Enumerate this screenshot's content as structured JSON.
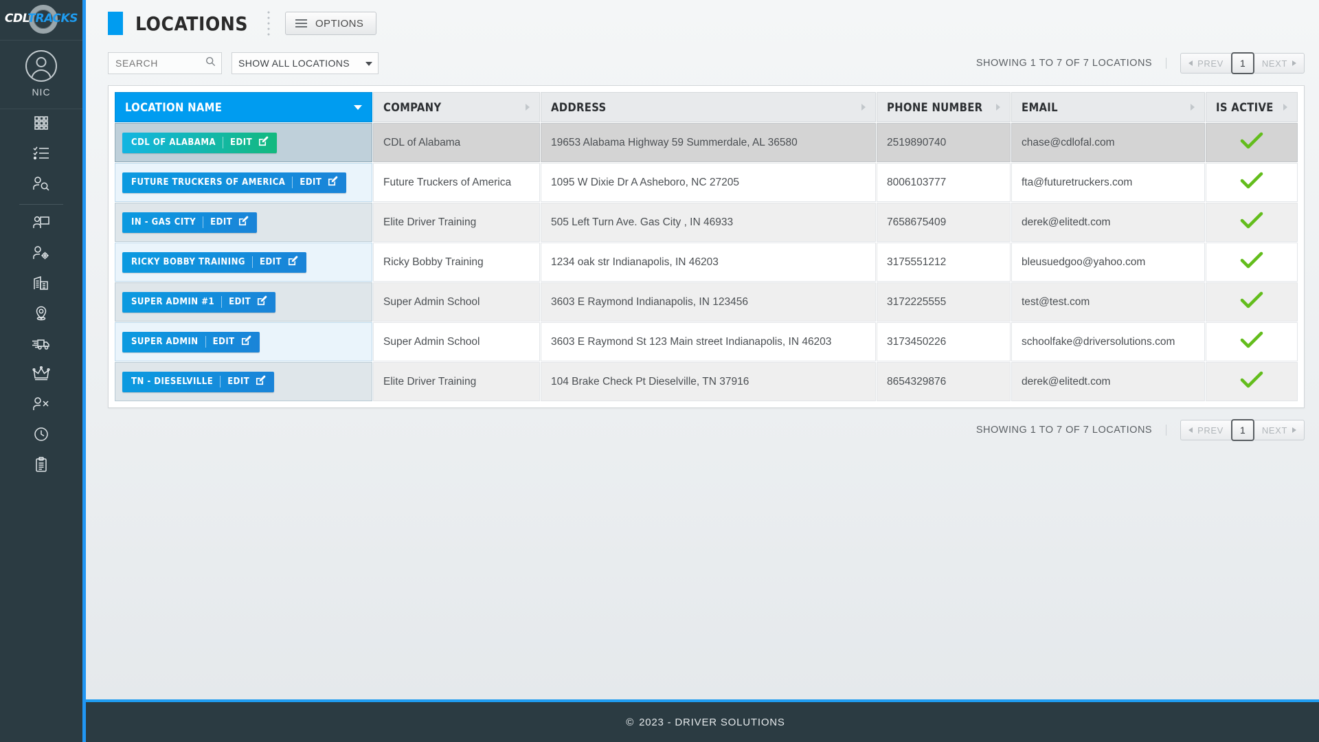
{
  "brand": {
    "name_part1": "CDL",
    "name_part2": "TRACKS"
  },
  "sidebar": {
    "user": {
      "name": "NIC",
      "avatar_icon": "user-avatar-icon"
    },
    "items": [
      {
        "icon": "grid-dashboard-icon",
        "name": "dashboard"
      },
      {
        "icon": "checklist-icon",
        "name": "tasks"
      },
      {
        "icon": "user-search-icon",
        "name": "student-search"
      },
      {
        "icon": "presentation-user-icon",
        "name": "training"
      },
      {
        "icon": "user-settings-icon",
        "name": "user-settings"
      },
      {
        "icon": "building-icon",
        "name": "companies"
      },
      {
        "icon": "location-pin-icon",
        "name": "locations"
      },
      {
        "icon": "truck-icon",
        "name": "vehicles"
      },
      {
        "icon": "crown-icon",
        "name": "admin"
      },
      {
        "icon": "user-remove-icon",
        "name": "remove-user"
      },
      {
        "icon": "clock-icon",
        "name": "hours"
      },
      {
        "icon": "clipboard-icon",
        "name": "reports"
      }
    ]
  },
  "header": {
    "title": "LOCATIONS",
    "options_label": "OPTIONS",
    "accent_color": "#009cf0"
  },
  "toolbar": {
    "search_placeholder": "SEARCH",
    "search_value": "",
    "filter_selected": "SHOW ALL LOCATIONS",
    "filter_options": [
      "SHOW ALL LOCATIONS"
    ],
    "showing_text": "SHOWING 1 TO 7 OF 7 LOCATIONS",
    "pagination": {
      "prev_label": "PREV",
      "page_label": "1",
      "next_label": "NEXT"
    }
  },
  "table": {
    "columns": [
      {
        "label": "LOCATION NAME",
        "sorted": true,
        "sort_dir": "desc"
      },
      {
        "label": "COMPANY",
        "sorted": false
      },
      {
        "label": "ADDRESS",
        "sorted": false
      },
      {
        "label": "PHONE NUMBER",
        "sorted": false
      },
      {
        "label": "EMAIL",
        "sorted": false
      },
      {
        "label": "IS ACTIVE",
        "sorted": false
      }
    ],
    "edit_label": "EDIT",
    "rows": [
      {
        "location_name": "CDL OF ALABAMA",
        "company": "CDL of Alabama",
        "address": "19653 Alabama Highway 59 Summerdale, AL 36580",
        "phone": "2519890740",
        "email": "chase@cdlofal.com",
        "is_active": true,
        "hover": true
      },
      {
        "location_name": "FUTURE TRUCKERS OF AMERICA",
        "company": "Future Truckers of America",
        "address": "1095 W Dixie Dr A Asheboro, NC 27205",
        "phone": "8006103777",
        "email": "fta@futuretruckers.com",
        "is_active": true,
        "hover": false
      },
      {
        "location_name": "IN - GAS CITY",
        "company": "Elite Driver Training",
        "address": "505 Left Turn Ave. Gas City , IN 46933",
        "phone": "7658675409",
        "email": "derek@elitedt.com",
        "is_active": true,
        "hover": false
      },
      {
        "location_name": "RICKY BOBBY TRAINING",
        "company": "Ricky Bobby Training",
        "address": "1234 oak str Indianapolis, IN 46203",
        "phone": "3175551212",
        "email": "bleusuedgoo@yahoo.com",
        "is_active": true,
        "hover": false
      },
      {
        "location_name": "SUPER ADMIN #1",
        "company": "Super Admin School",
        "address": "3603 E Raymond Indianapolis, IN 123456",
        "phone": "3172225555",
        "email": "test@test.com",
        "is_active": true,
        "hover": false
      },
      {
        "location_name": "SUPER ADMIN",
        "company": "Super Admin School",
        "address": "3603 E Raymond St 123 Main street Indianapolis, IN 46203",
        "phone": "3173450226",
        "email": "schoolfake@driversolutions.com",
        "is_active": true,
        "hover": false
      },
      {
        "location_name": "TN - DIESELVILLE",
        "company": "Elite Driver Training",
        "address": "104 Brake Check Pt Dieselville, TN 37916",
        "phone": "8654329876",
        "email": "derek@elitedt.com",
        "is_active": true,
        "hover": false
      }
    ]
  },
  "footer": {
    "copyright_symbol": "©",
    "text": "2023 - DRIVER SOLUTIONS"
  }
}
